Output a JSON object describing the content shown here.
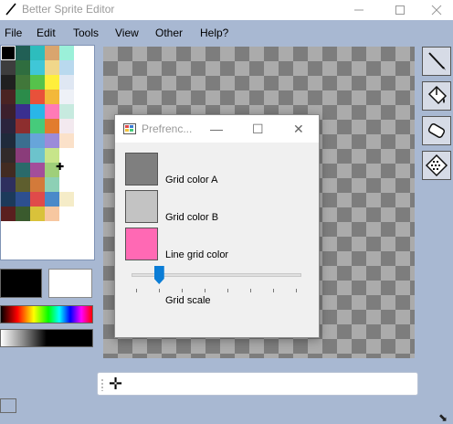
{
  "window": {
    "title": "Better Sprite Editor"
  },
  "menu": [
    "File",
    "Edit",
    "Tools",
    "View",
    "Other",
    "Help?"
  ],
  "palette": {
    "colors": [
      "#000000",
      "#215f55",
      "#2dbdbd",
      "#d9a56e",
      "#9bf0d9",
      "#3d3d3d",
      "#2f6d3f",
      "#3fc7d7",
      "#f0d78a",
      "#b9d9ee",
      "#202020",
      "#41773a",
      "#56c24b",
      "#ffef3b",
      "#dfe7f3",
      "#4a2323",
      "#2b8c4a",
      "#e8513a",
      "#f3b83a",
      "#eef1f7",
      "#3c1f2c",
      "#3a2f8f",
      "#29b6e8",
      "#ff7ab6",
      "#c7eadf",
      "#2b243d",
      "#8d2e2e",
      "#46cb7b",
      "#e27c2e",
      "#f3e9ef",
      "#1f2a3b",
      "#3b6e8f",
      "#67a5da",
      "#9b8bd9",
      "#fbe1c9",
      "#312a2a",
      "#8a3c7a",
      "#6cc3cc",
      "#c7e58a",
      "#ffffff",
      "#422b21",
      "#2a6a6a",
      "#a34e9a",
      "#9fcf7a",
      "#ffffff",
      "#2e2f5e",
      "#5e5e2e",
      "#d37a3a",
      "#8dd0b5",
      "#ffffff",
      "#1c3a5a",
      "#2d4f8f",
      "#e04a4a",
      "#4a89c9",
      "#f5ecc8",
      "#5a1f1f",
      "#3a5a2d",
      "#d9c23a",
      "#f7c7a0",
      "#ffffff"
    ],
    "selected_index": 0
  },
  "colors": {
    "primary": "#000000",
    "secondary": "#ffffff",
    "accent": "#0b7dd6"
  },
  "tools": [
    {
      "name": "pencil-icon"
    },
    {
      "name": "fill-bucket-icon"
    },
    {
      "name": "eraser-icon"
    },
    {
      "name": "dither-icon"
    }
  ],
  "dialog": {
    "title": "Prefrenc...",
    "grid_color_a": {
      "label": "Grid color A",
      "color": "#7f7f7f"
    },
    "grid_color_b": {
      "label": "Grid color B",
      "color": "#c3c3c3"
    },
    "line_grid_color": {
      "label": "Line grid color",
      "color": "#ff69b4"
    },
    "grid_scale": {
      "label": "Grid scale",
      "value_fraction": 0.16
    }
  }
}
